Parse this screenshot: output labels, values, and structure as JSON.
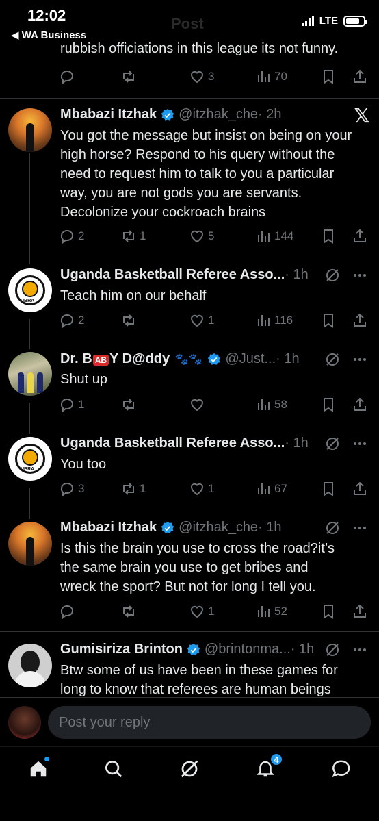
{
  "status_bar": {
    "time": "12:02",
    "back_app": "◀ WA Business",
    "network": "LTE",
    "faded_title": "Post"
  },
  "top_tweet": {
    "text": "rubbish officiations in this league its not funny.",
    "replies": "",
    "retweets": "",
    "likes": "3",
    "views": "70"
  },
  "tweets": [
    {
      "name": "Mbabazi Itzhak",
      "handle": "@itzhak_che",
      "time": "· 2h",
      "verified": true,
      "body": [
        "You got the message but insist on being on your",
        "high horse? Respond to his query without the",
        "need to request him to talk to you a particular",
        "way, you are not gods you are servants.",
        "Decolonize your cockroach brains"
      ],
      "replies": "2",
      "retweets": "1",
      "likes": "5",
      "views": "144"
    },
    {
      "name": "Uganda Basketball Referee Asso...",
      "handle": "",
      "time": "· 1h",
      "verified": false,
      "body": [
        "Teach him on our behalf"
      ],
      "replies": "2",
      "retweets": "",
      "likes": "1",
      "views": "116"
    },
    {
      "name_prefix": "Dr. B",
      "name_badge": "AB",
      "name_suffix": "Y D@ddy",
      "name_paws": "🐾🐾",
      "handle": "@Just...",
      "time": "· 1h",
      "verified": true,
      "body": [
        "Shut up"
      ],
      "replies": "1",
      "retweets": "",
      "likes": "",
      "views": "58"
    },
    {
      "name": "Uganda Basketball Referee Asso...",
      "handle": "",
      "time": "· 1h",
      "verified": false,
      "body": [
        "You too"
      ],
      "replies": "3",
      "retweets": "1",
      "likes": "1",
      "views": "67"
    },
    {
      "name": "Mbabazi Itzhak",
      "handle": "@itzhak_che",
      "time": "· 1h",
      "verified": true,
      "body": [
        "Is this the brain you use to cross the road?it’s",
        "the same brain you use to get bribes and",
        "wreck the sport? But not for long I tell you."
      ],
      "replies": "",
      "retweets": "",
      "likes": "1",
      "views": "52"
    },
    {
      "name": "Gumisiriza Brinton",
      "handle": "@brintonma...",
      "time": "· 1h",
      "verified": true,
      "body": [
        "Btw some of us have been in these games for",
        "long to know that referees are human beings"
      ]
    }
  ],
  "ubra_logo_text": "UBRA",
  "reply_placeholder": "Post your reply",
  "notifications_count": "4",
  "colors": {
    "accent": "#1d9bf0",
    "background": "#000000",
    "muted": "#71767b",
    "text": "#e7e9ea"
  }
}
